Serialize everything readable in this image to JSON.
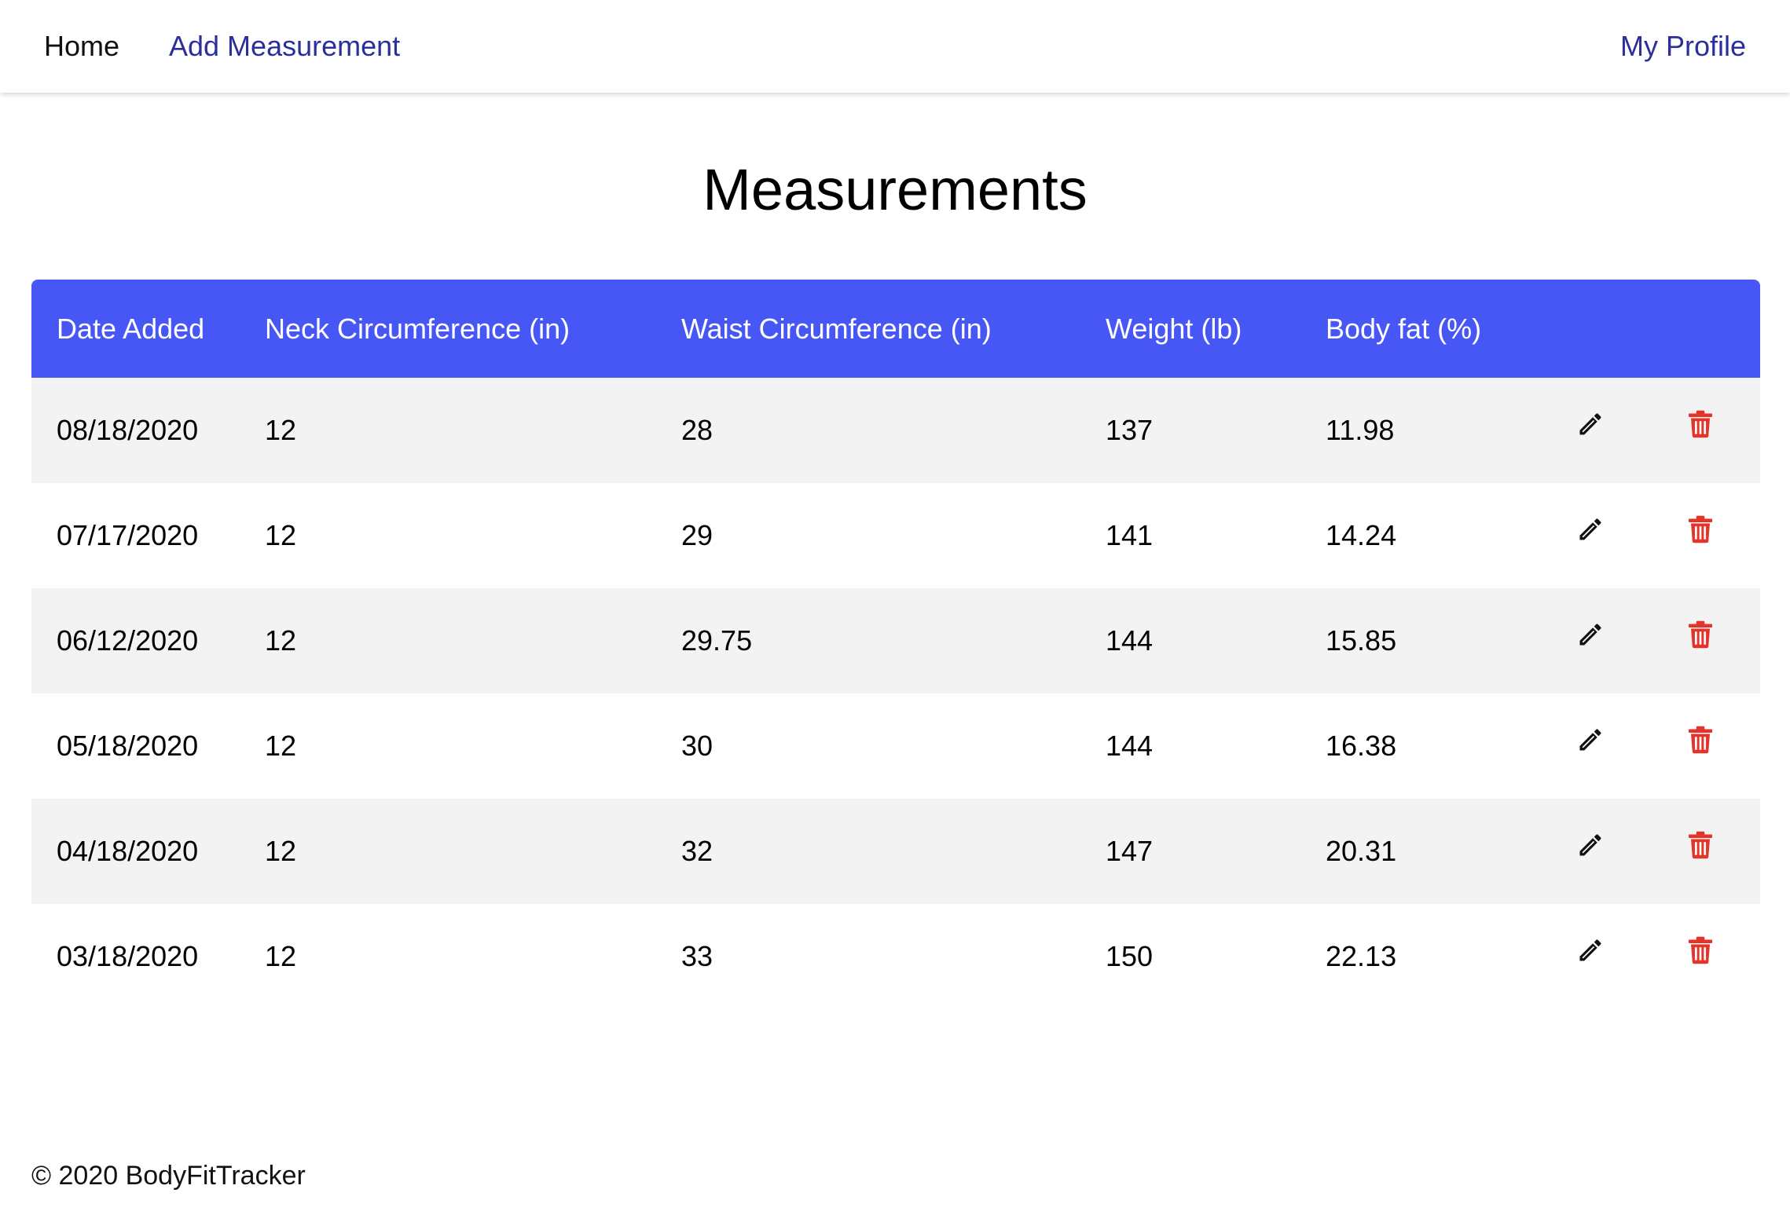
{
  "nav": {
    "home": "Home",
    "add_measurement": "Add Measurement",
    "my_profile": "My Profile"
  },
  "page_title": "Measurements",
  "table": {
    "columns": [
      "Date Added",
      "Neck Circumference (in)",
      "Waist Circumference (in)",
      "Weight (lb)",
      "Body fat (%)"
    ],
    "rows": [
      {
        "date": "08/18/2020",
        "neck": "12",
        "waist": "28",
        "weight": "137",
        "body_fat": "11.98"
      },
      {
        "date": "07/17/2020",
        "neck": "12",
        "waist": "29",
        "weight": "141",
        "body_fat": "14.24"
      },
      {
        "date": "06/12/2020",
        "neck": "12",
        "waist": "29.75",
        "weight": "144",
        "body_fat": "15.85"
      },
      {
        "date": "05/18/2020",
        "neck": "12",
        "waist": "30",
        "weight": "144",
        "body_fat": "16.38"
      },
      {
        "date": "04/18/2020",
        "neck": "12",
        "waist": "32",
        "weight": "147",
        "body_fat": "20.31"
      },
      {
        "date": "03/18/2020",
        "neck": "12",
        "waist": "33",
        "weight": "150",
        "body_fat": "22.13"
      }
    ]
  },
  "icons": {
    "edit": "pencil-icon",
    "delete": "trash-icon"
  },
  "colors": {
    "header_bg": "#4757f6",
    "link": "#2a2f9c",
    "delete": "#e5332a",
    "row_alt": "#f3f3f3"
  },
  "footer": "© 2020 BodyFitTracker"
}
